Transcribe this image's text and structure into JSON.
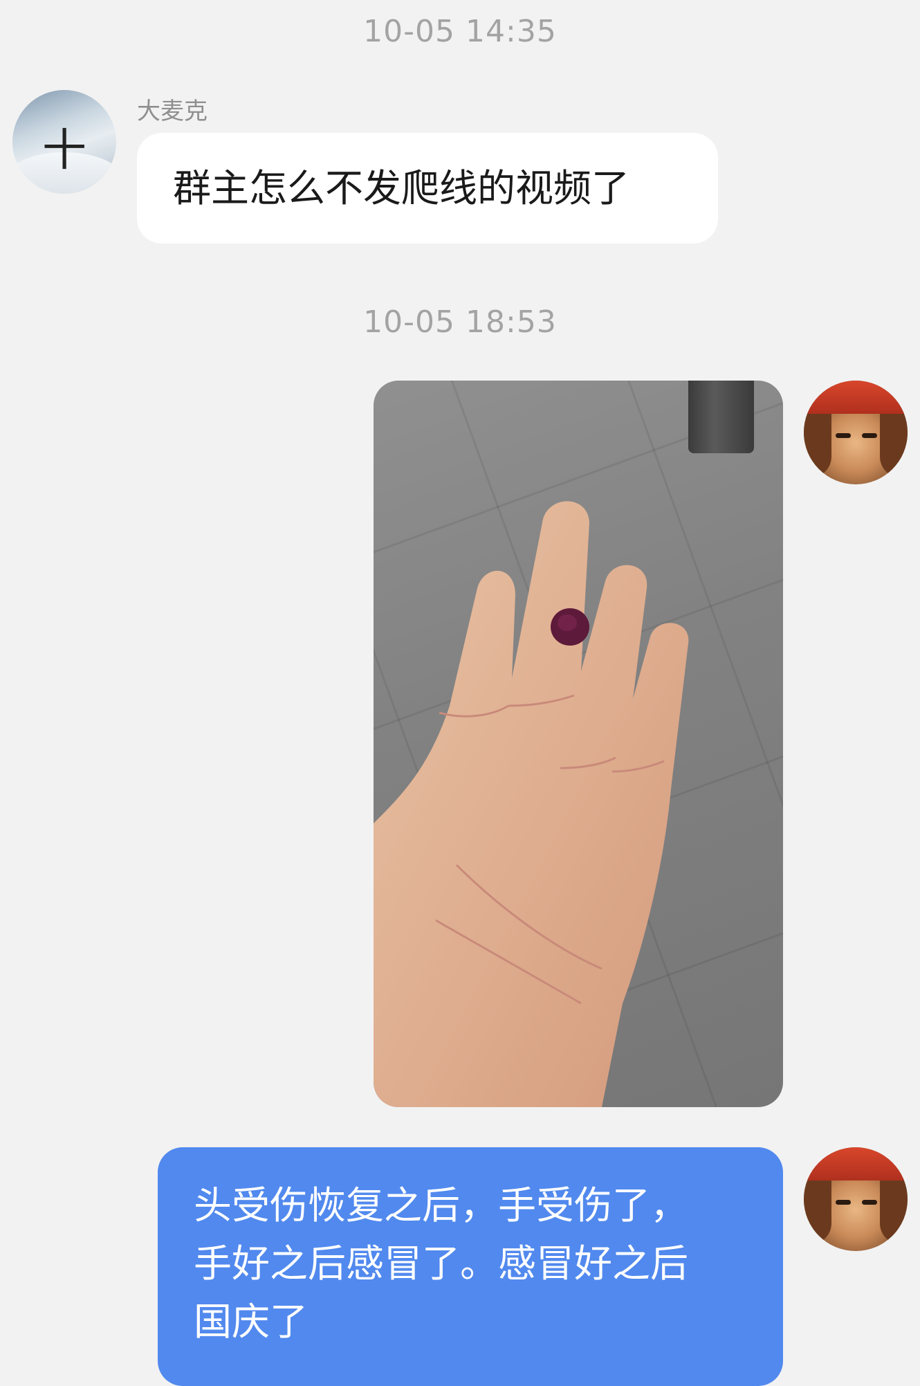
{
  "chat": {
    "timestamps": [
      "10-05 14:35",
      "10-05 18:53"
    ],
    "messages": [
      {
        "sender_name": "大麦克",
        "avatar_icon": "snowy-mountain-cross-avatar",
        "avatar_glyph": "十",
        "text": "群主怎么不发爬线的视频了"
      },
      {
        "type": "image",
        "image_icon": "hand-with-blood-blister-photo",
        "avatar_icon": "pirate-bandana-avatar"
      },
      {
        "lines": [
          "头受伤恢复之后，手受伤了，",
          "手好之后感冒了。感冒好之后",
          "国庆了"
        ],
        "avatar_icon": "pirate-bandana-avatar"
      }
    ]
  },
  "colors": {
    "background": "#f2f2f2",
    "incoming_bubble": "#ffffff",
    "outgoing_bubble": "#5189ee",
    "timestamp_text": "#a3a3a3"
  }
}
